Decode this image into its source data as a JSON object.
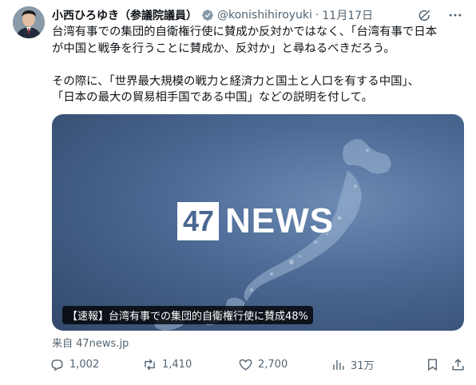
{
  "author": {
    "name": "小西ひろゆき（参議院議員）",
    "handle": "@konishihiroyuki",
    "date": "11月17日"
  },
  "post": {
    "lines": [
      "台湾有事での集団的自衛権行使に賛成か反対かではなく、「台湾有事で日本",
      "が中国と戦争を行うことに賛成か、反対か」と尋ねるべきだろう。",
      "その際に、「世界最大規模の戦力と経済力と国土と人口を有する中国」、",
      "「日本の最大の貿易相手国である中国」などの説明を付して。"
    ]
  },
  "card": {
    "logo_number": "47",
    "logo_word": "NEWS",
    "caption": "【速報】台湾有事での集団的自衛権行使に賛成48%",
    "source": "来自 47news.jp"
  },
  "metrics": {
    "replies": "1,002",
    "reposts": "1,410",
    "likes": "2,700",
    "views": "31万"
  },
  "icons": {
    "verified": "verified-badge-icon",
    "grok": "grok-icon",
    "more": "more-icon",
    "reply": "reply-icon",
    "repost": "repost-icon",
    "like": "heart-icon",
    "views": "views-icon",
    "bookmark": "bookmark-icon",
    "share": "share-icon"
  },
  "colors": {
    "text": "#0f1419",
    "secondary": "#536471",
    "verified": "#829aab",
    "card_bg": "#4d6b96"
  }
}
